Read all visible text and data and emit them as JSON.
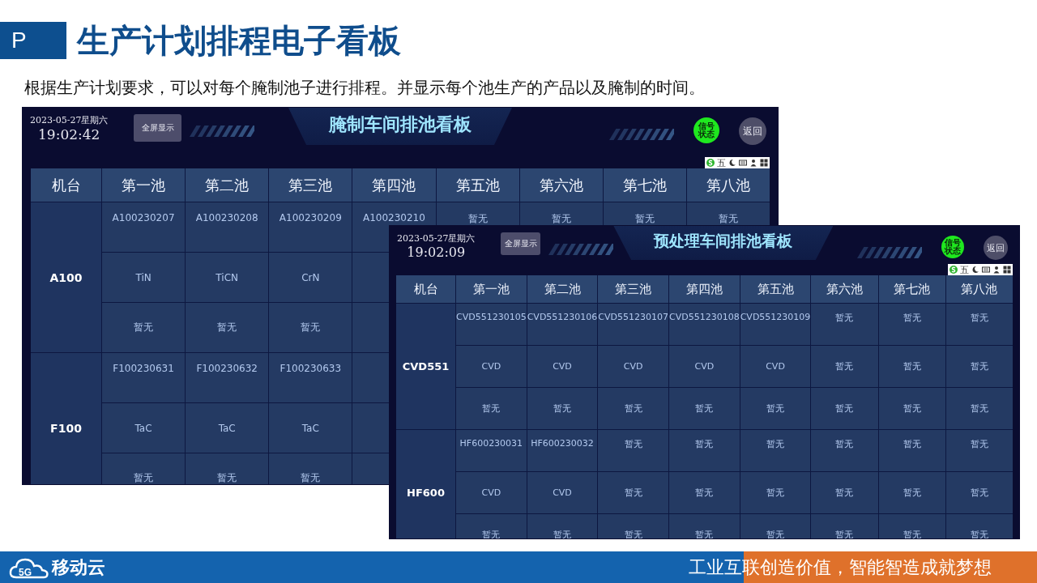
{
  "slide": {
    "section_mark": "P",
    "title": "生产计划排程电子看板",
    "description": "根据生产计划要求，可以对每个腌制池子进行排程。并显示每个池生产的产品以及腌制的时间。"
  },
  "boards": [
    {
      "date": "2023-05-27星期六",
      "time": "19:02:42",
      "fullscreen_button": "全屏显示",
      "title": "腌制车间排池看板",
      "signal": {
        "label": "信号状态",
        "ok": true
      },
      "back_button": "返回",
      "ime_toolbar": {
        "mode": "五"
      },
      "columns": [
        "机台",
        "第一池",
        "第二池",
        "第三池",
        "第四池",
        "第五池",
        "第六池",
        "第七池",
        "第八池"
      ],
      "rows": [
        {
          "machine": "A100",
          "codes": [
            "A100230207",
            "A100230208",
            "A100230209",
            "A100230210",
            "暂无",
            "暂无",
            "暂无",
            "暂无"
          ],
          "coatings": [
            "TiN",
            "TiCN",
            "CrN"
          ],
          "times": [
            "暂无",
            "暂无",
            "暂无"
          ]
        },
        {
          "machine": "F100",
          "codes": [
            "F100230631",
            "F100230632",
            "F100230633"
          ],
          "coatings": [
            "TaC",
            "TaC",
            "TaC"
          ],
          "times": [
            "暂无",
            "暂无",
            "暂无"
          ]
        }
      ]
    },
    {
      "date": "2023-05-27星期六",
      "time": "19:02:09",
      "fullscreen_button": "全屏显示",
      "title": "预处理车间排池看板",
      "signal": {
        "label": "信号状态",
        "ok": true
      },
      "back_button": "返回",
      "ime_toolbar": {
        "mode": "五"
      },
      "columns": [
        "机台",
        "第一池",
        "第二池",
        "第三池",
        "第四池",
        "第五池",
        "第六池",
        "第七池",
        "第八池"
      ],
      "rows": [
        {
          "machine": "CVD551",
          "codes": [
            "CVD551230105",
            "CVD551230106",
            "CVD551230107",
            "CVD551230108",
            "CVD551230109",
            "暂无",
            "暂无",
            "暂无"
          ],
          "coatings": [
            "CVD",
            "CVD",
            "CVD",
            "CVD",
            "CVD",
            "暂无",
            "暂无",
            "暂无"
          ],
          "times": [
            "暂无",
            "暂无",
            "暂无",
            "暂无",
            "暂无",
            "暂无",
            "暂无",
            "暂无"
          ]
        },
        {
          "machine": "HF600",
          "codes": [
            "HF600230031",
            "HF600230032",
            "暂无",
            "暂无",
            "暂无",
            "暂无",
            "暂无",
            "暂无"
          ],
          "coatings": [
            "CVD",
            "CVD",
            "暂无",
            "暂无",
            "暂无",
            "暂无",
            "暂无",
            "暂无"
          ],
          "times": [
            "暂无",
            "暂无",
            "暂无",
            "暂无",
            "暂无",
            "暂无",
            "暂无",
            "暂无"
          ]
        }
      ]
    }
  ],
  "footer": {
    "logo_badge": "5G",
    "brand": "移动云",
    "slogan": "工业互联创造价值，智能智造成就梦想"
  }
}
